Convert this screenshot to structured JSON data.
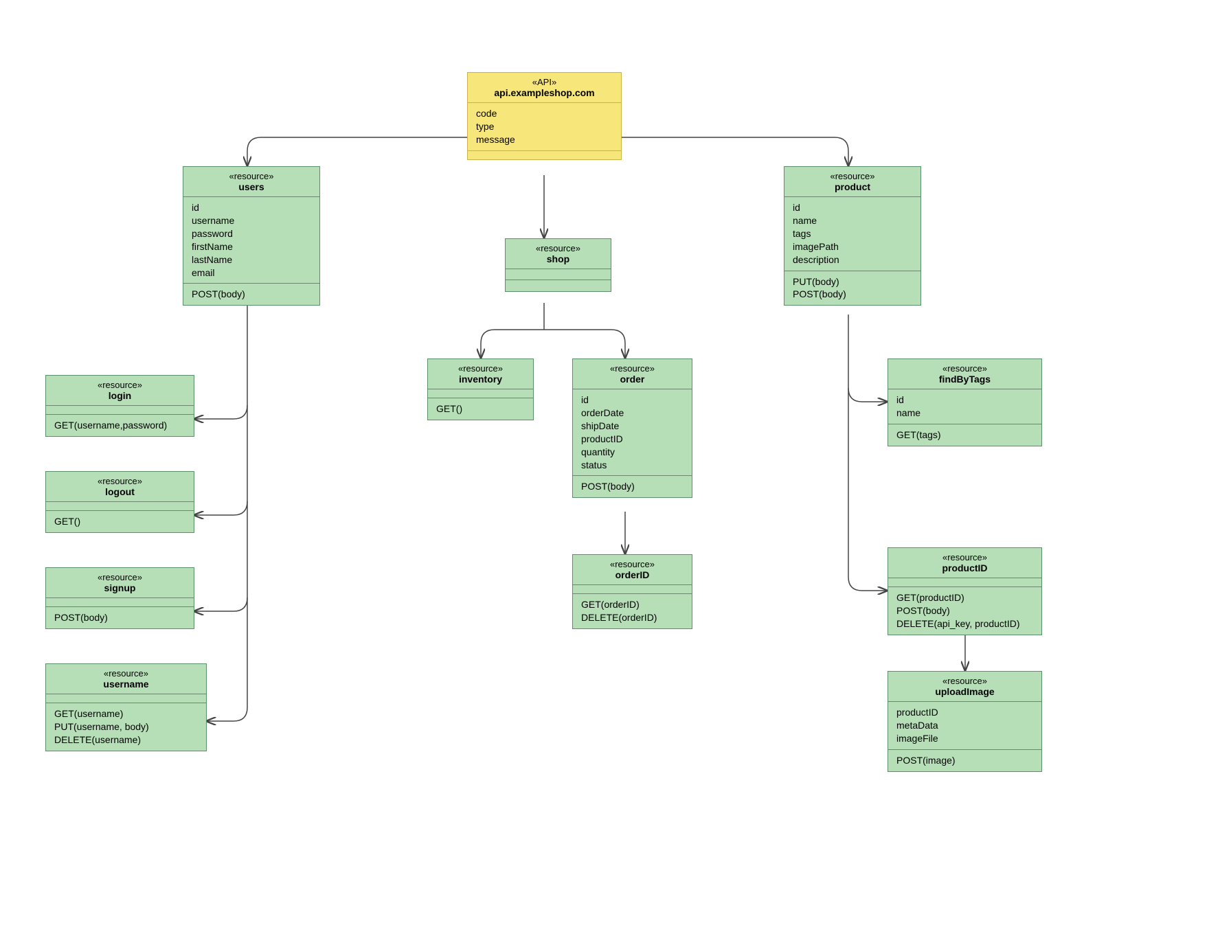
{
  "api": {
    "tag": "«API»",
    "name": "api.exampleshop.com",
    "attrs": [
      "code",
      "type",
      "message"
    ]
  },
  "users": {
    "tag": "«resource»",
    "name": "users",
    "attrs": [
      "id",
      "username",
      "password",
      "firstName",
      "lastName",
      "email"
    ],
    "ops": [
      "POST(body)"
    ]
  },
  "login": {
    "tag": "«resource»",
    "name": "login",
    "ops": [
      "GET(username,password)"
    ]
  },
  "logout": {
    "tag": "«resource»",
    "name": "logout",
    "ops": [
      "GET()"
    ]
  },
  "signup": {
    "tag": "«resource»",
    "name": "signup",
    "ops": [
      "POST(body)"
    ]
  },
  "username": {
    "tag": "«resource»",
    "name": "username",
    "ops": [
      "GET(username)",
      "PUT(username, body)",
      "DELETE(username)"
    ]
  },
  "shop": {
    "tag": "«resource»",
    "name": "shop"
  },
  "inventory": {
    "tag": "«resource»",
    "name": "inventory",
    "ops": [
      "GET()"
    ]
  },
  "order": {
    "tag": "«resource»",
    "name": "order",
    "attrs": [
      "id",
      "orderDate",
      "shipDate",
      "productID",
      "quantity",
      "status"
    ],
    "ops": [
      "POST(body)"
    ]
  },
  "orderID": {
    "tag": "«resource»",
    "name": "orderID",
    "ops": [
      "GET(orderID)",
      "DELETE(orderID)"
    ]
  },
  "product": {
    "tag": "«resource»",
    "name": "product",
    "attrs": [
      "id",
      "name",
      "tags",
      "imagePath",
      "description"
    ],
    "ops": [
      "PUT(body)",
      "POST(body)"
    ]
  },
  "findByTags": {
    "tag": "«resource»",
    "name": "findByTags",
    "attrs": [
      "id",
      "name"
    ],
    "ops": [
      "GET(tags)"
    ]
  },
  "productID": {
    "tag": "«resource»",
    "name": "productID",
    "ops": [
      "GET(productID)",
      "POST(body)",
      "DELETE(api_key, productID)"
    ]
  },
  "uploadImage": {
    "tag": "«resource»",
    "name": "uploadImage",
    "attrs": [
      "productID",
      "metaData",
      "imageFile"
    ],
    "ops": [
      "POST(image)"
    ]
  }
}
